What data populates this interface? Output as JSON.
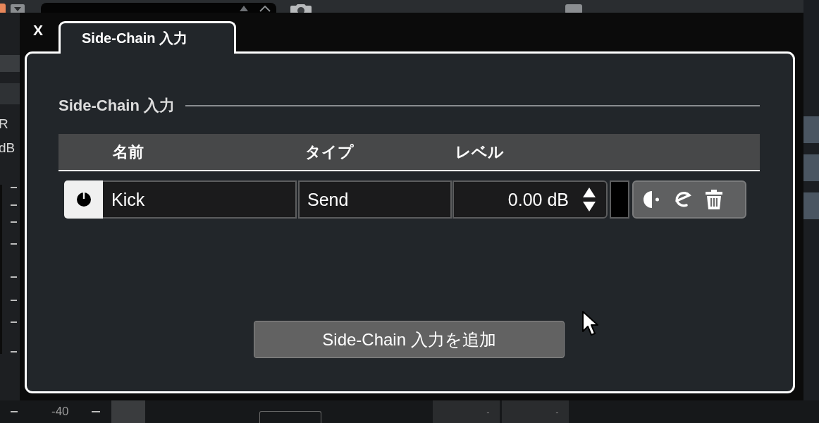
{
  "background": {
    "meter_labels": [
      "R",
      "dB"
    ],
    "scale_label": "-40",
    "readouts": [
      "-",
      "-"
    ]
  },
  "dialog": {
    "close_label": "X",
    "tabs": [
      {
        "label": "Side-Chain 入力",
        "selected": true
      }
    ],
    "section_title": "Side-Chain 入力",
    "table": {
      "columns": [
        "名前",
        "タイプ",
        "レベル"
      ],
      "rows": [
        {
          "enabled": true,
          "name": "Kick",
          "type": "Send",
          "level": "0.00 dB",
          "color": "#000000"
        }
      ]
    },
    "add_button": "Side-Chain 入力を追加"
  }
}
